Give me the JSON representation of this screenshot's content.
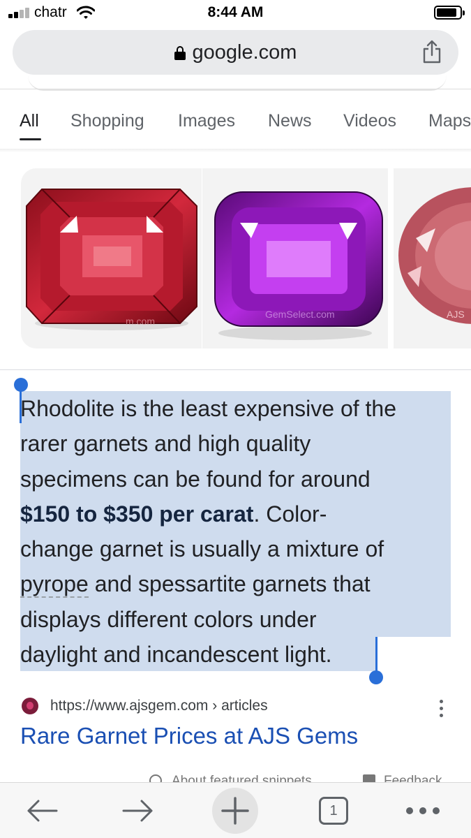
{
  "status_bar": {
    "carrier": "chatr",
    "time": "8:44 AM",
    "signal_bars_filled": 2,
    "signal_bars_total": 4
  },
  "url_bar": {
    "domain": "google.com",
    "icons": [
      "lock-icon",
      "share-icon"
    ]
  },
  "tabs": [
    {
      "label": "All",
      "active": true
    },
    {
      "label": "Shopping",
      "active": false
    },
    {
      "label": "Images",
      "active": false
    },
    {
      "label": "News",
      "active": false
    },
    {
      "label": "Videos",
      "active": false
    },
    {
      "label": "Maps",
      "active": false
    }
  ],
  "images": [
    {
      "subject": "red rhodolite garnet, emerald cut",
      "watermark": "m.com"
    },
    {
      "subject": "purple rhodolite garnet, cushion cut",
      "watermark": "GemSelect.com"
    },
    {
      "subject": "pink oval garnet",
      "watermark": "AJS"
    }
  ],
  "snippet": {
    "lines": [
      "Rhodolite is the least expensive of the",
      "rarer garnets and high quality",
      "specimens can be found for around",
      "$150 to $350 per carat",
      ". Color-",
      "change garnet is usually a mixture of",
      "pyrope",
      " and spessartite garnets that",
      "displays different colors under",
      "daylight and incandescent light."
    ],
    "highlighted_phrase": "$150 to $350 per carat"
  },
  "source": {
    "url": "https://www.ajsgem.com",
    "breadcrumb": " › articles",
    "title": "Rare Garnet Prices at AJS Gems"
  },
  "footer_links": [
    "About featured snippets",
    "Feedback"
  ],
  "toolbar": {
    "tab_count": "1",
    "buttons": [
      "back-arrow-icon",
      "forward-arrow-icon",
      "new-tab-plus-icon",
      "tab-switcher-icon",
      "more-menu-icon"
    ]
  },
  "colors": {
    "accent_blue": "#1a4fb3",
    "selection": "#cfdcee",
    "handle": "#2a6fd8",
    "url_bar_bg": "#e9eaec"
  }
}
